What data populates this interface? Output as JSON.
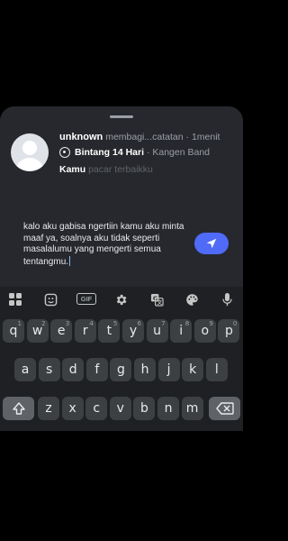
{
  "notification": {
    "username": "unknown",
    "activity": "membagi...catatan",
    "separator": "·",
    "time": "1menit",
    "song_title": "Bintang 14 Hari",
    "artist": "Kangen Band",
    "lyric_highlight": "Kamu",
    "lyric_rest": "pacar terbaikku"
  },
  "composer": {
    "text": "kalo aku gabisa ngertiin kamu aku minta maaf ya, soalnya aku tidak seperti masalalumu yang mengerti semua tentangmu."
  },
  "keyboard": {
    "toolbar": [
      "apps-grid-icon",
      "sticker-icon",
      "GIF",
      "gear-icon",
      "translate-icon",
      "palette-icon",
      "microphone-icon"
    ],
    "gif_label": "GIF",
    "row1": [
      "q",
      "w",
      "e",
      "r",
      "t",
      "y",
      "u",
      "i",
      "o",
      "p"
    ],
    "row1_hints": [
      "1",
      "2",
      "3",
      "4",
      "5",
      "6",
      "7",
      "8",
      "9",
      "0"
    ],
    "row2": [
      "a",
      "s",
      "d",
      "f",
      "g",
      "h",
      "j",
      "k",
      "l"
    ],
    "row3": [
      "z",
      "x",
      "c",
      "v",
      "b",
      "n",
      "m"
    ]
  }
}
